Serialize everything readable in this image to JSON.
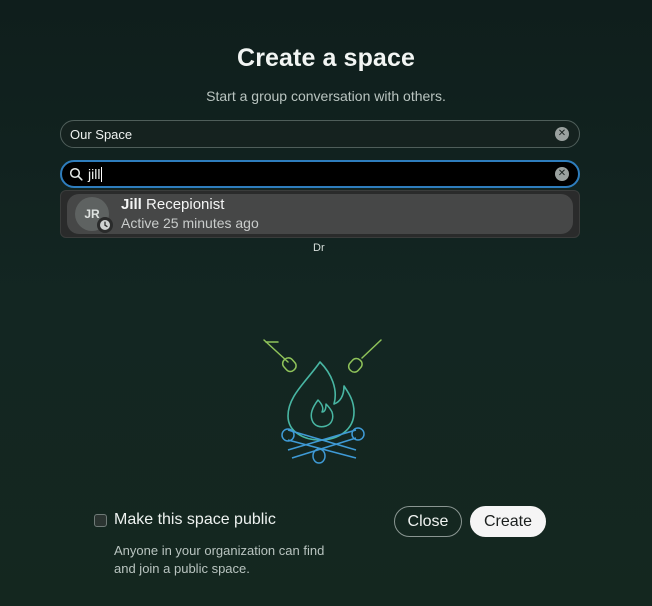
{
  "dialog": {
    "title": "Create a space",
    "subtitle": "Start a group conversation with others."
  },
  "space_name": {
    "value": "Our Space"
  },
  "search": {
    "value": "jill"
  },
  "results": [
    {
      "initials": "JR",
      "name_match": "Jill",
      "name_rest": " Recepionist",
      "status": "Active 25 minutes ago"
    }
  ],
  "obscured_text": "Dr",
  "public_option": {
    "label": "Make this space public",
    "checked": false,
    "help": "Anyone in your organization can find and join a public space."
  },
  "buttons": {
    "close": "Close",
    "create": "Create"
  },
  "icons": {
    "search": "search-icon",
    "clear": "clear-icon",
    "presence": "clock-icon",
    "illustration": "campfire-illustration"
  },
  "colors": {
    "focus": "#2e7dbd",
    "illustration_green": "#8fc35a",
    "illustration_teal": "#48b6a3",
    "illustration_blue": "#3f9ad6"
  }
}
